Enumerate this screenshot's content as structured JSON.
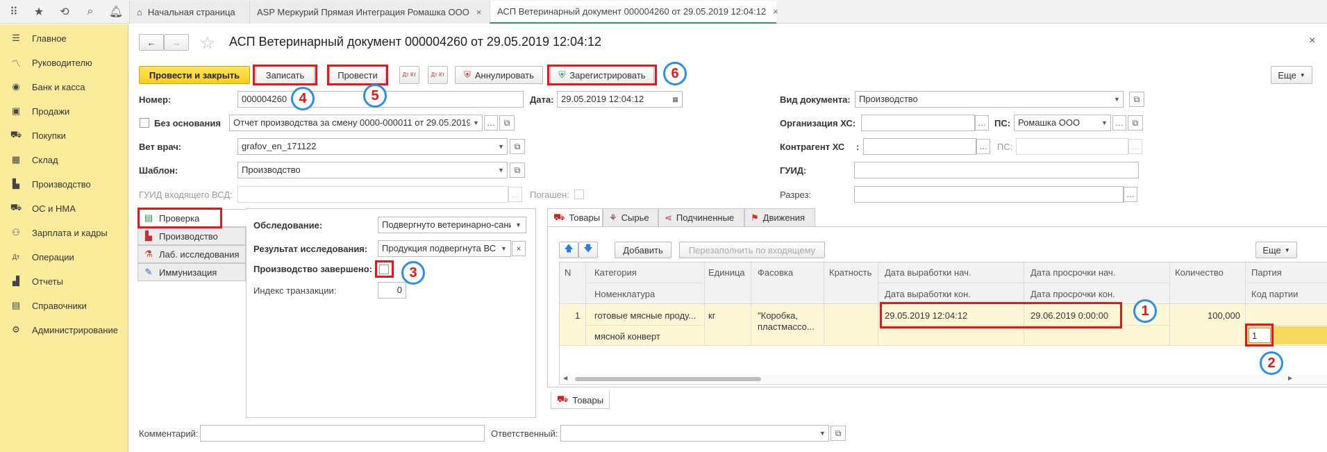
{
  "top_tabs": [
    {
      "label": "Начальная страница"
    },
    {
      "label": "ASP Меркурий Прямая Интеграция Ромашка ООО"
    },
    {
      "label": "АСП Ветеринарный документ 000004260 от 29.05.2019 12:04:12"
    }
  ],
  "sidebar": {
    "items": [
      {
        "label": "Главное",
        "icon": "menu-icon"
      },
      {
        "label": "Руководителю",
        "icon": "chart-line-icon"
      },
      {
        "label": "Банк и касса",
        "icon": "coin-icon"
      },
      {
        "label": "Продажи",
        "icon": "bag-icon"
      },
      {
        "label": "Покупки",
        "icon": "cart-icon"
      },
      {
        "label": "Склад",
        "icon": "grid-icon"
      },
      {
        "label": "Производство",
        "icon": "factory-icon"
      },
      {
        "label": "ОС и НМА",
        "icon": "truck-icon"
      },
      {
        "label": "Зарплата и кадры",
        "icon": "people-icon"
      },
      {
        "label": "Операции",
        "icon": "dt-kt-icon"
      },
      {
        "label": "Отчеты",
        "icon": "bar-chart-icon"
      },
      {
        "label": "Справочники",
        "icon": "book-icon"
      },
      {
        "label": "Администрирование",
        "icon": "gear-icon"
      }
    ]
  },
  "doc": {
    "title": "АСП Ветеринарный документ 000004260 от 29.05.2019 12:04:12"
  },
  "toolbar": {
    "post_close": "Провести и закрыть",
    "save": "Записать",
    "post": "Провести",
    "dtkt1": "Дт Кт",
    "dtkt2": "Дт Кт",
    "annul": "Аннулировать",
    "register": "Зарегистрировать",
    "more": "Еще"
  },
  "form": {
    "number_label": "Номер:",
    "number": "000004260",
    "date_label": "Дата:",
    "date": "29.05.2019 12:04:12",
    "doctype_label": "Вид документа:",
    "doctype": "Производство",
    "no_basis_label": "Без основания",
    "basis": "Отчет производства за смену 0000-000011 от 29.05.2019",
    "org_label": "Организация ХС:",
    "org": "",
    "ps1_label": "ПС:",
    "ps1": "Ромашка ООО",
    "vet_label": "Вет врач:",
    "vet": "grafov_en_171122",
    "contr_label": "Контрагент ХС",
    "contr_colon": ":",
    "contr": "",
    "ps2_label": "ПС:",
    "ps2": "",
    "template_label": "Шаблон:",
    "template": "Производство",
    "guid_label": "ГУИД:",
    "guid": "",
    "guid_in_label": "ГУИД входящего ВСД:",
    "guid_in": "",
    "repaid_label": "Погашен:",
    "razrez_label": "Разрез:",
    "razrez": ""
  },
  "left_tabs": [
    {
      "label": "Проверка",
      "icon": "check-doc-icon"
    },
    {
      "label": "Производство",
      "icon": "factory-icon"
    },
    {
      "label": "Лаб. исследования",
      "icon": "flask-icon"
    },
    {
      "label": "Иммунизация",
      "icon": "syringe-icon"
    }
  ],
  "check": {
    "exam_label": "Обследование:",
    "exam": "Подвергнуто ветеринарно-сани",
    "result_label": "Результат исследования:",
    "result": "Продукция подвергнута ВС",
    "done_label": "Производство завершено:",
    "trans_label": "Индекс транзакции:",
    "trans": "0"
  },
  "right_tabs": [
    {
      "label": "Товары",
      "icon": "cart-icon"
    },
    {
      "label": "Сырье",
      "icon": "raw-icon"
    },
    {
      "label": "Подчиненные",
      "icon": "share-icon"
    },
    {
      "label": "Движения",
      "icon": "movement-icon"
    }
  ],
  "goods": {
    "add": "Добавить",
    "refill": "Перезаполнить по входящему",
    "more": "Еще",
    "bottom_tab": "Товары",
    "headers": {
      "n": "N",
      "cat": "Категория",
      "nom": "Номенклатура",
      "unit": "Единица",
      "pack": "Фасовка",
      "mult": "Кратность",
      "prod_start": "Дата выработки нач.",
      "prod_end": "Дата выработки кон.",
      "exp_start": "Дата просрочки нач.",
      "exp_end": "Дата просрочки кон.",
      "qty": "Количество",
      "batch": "Партия",
      "batch_code": "Код партии"
    },
    "rows": [
      {
        "n": "1",
        "cat": "готовые мясные проду...",
        "nom": "мясной конверт",
        "unit": "кг",
        "pack1": "\"Коробка,",
        "pack2": "пластмассо...",
        "prod_start": "29.05.2019 12:04:12",
        "exp_start": "29.06.2019 0:00:00",
        "qty": "100,000",
        "batch_code": "1"
      }
    ]
  },
  "footer": {
    "comment_label": "Комментарий:",
    "comment": "",
    "resp_label": "Ответственный:",
    "resp": ""
  },
  "annotations": [
    "1",
    "2",
    "3",
    "4",
    "5",
    "6"
  ],
  "colors": {
    "sidebar": "#fbec9c",
    "primary_button": "#f7cf17",
    "highlight_row": "#fdf7d6",
    "annotation_box": "#e8151b",
    "annotation_circle": "#2b8ee8"
  }
}
